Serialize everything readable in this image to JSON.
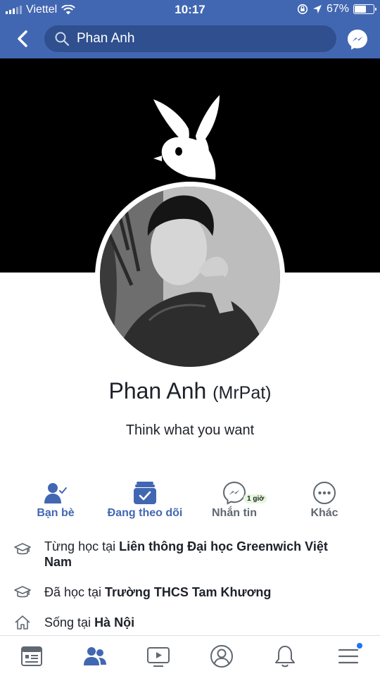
{
  "status_bar": {
    "carrier": "Viettel",
    "time": "10:17",
    "battery": "67%",
    "battery_level": 0.67
  },
  "search": {
    "query": "Phan Anh"
  },
  "profile": {
    "name": "Phan Anh",
    "alternate_name": "(MrPat)",
    "bio": "Think what you want"
  },
  "actions": [
    {
      "label": "Bạn bè",
      "icon": "friends-check-icon"
    },
    {
      "label": "Đang theo dõi",
      "icon": "following-check-icon"
    },
    {
      "label": "Nhắn tin",
      "icon": "messenger-icon",
      "badge": "1 giờ"
    },
    {
      "label": "Khác",
      "icon": "more-icon"
    }
  ],
  "info": [
    {
      "prefix": "Từng học tại ",
      "value": "Liên thông Đại học Greenwich Việt Nam",
      "icon": "graduation-cap-icon"
    },
    {
      "prefix": "Đã học tại ",
      "value": "Trường THCS Tam Khương",
      "icon": "graduation-cap-icon"
    },
    {
      "prefix": "Sống tại ",
      "value": "Hà Nội",
      "icon": "home-icon"
    }
  ],
  "bottom_nav": [
    "news-feed-icon",
    "friends-icon",
    "watch-icon",
    "profile-icon",
    "notifications-icon",
    "menu-icon"
  ],
  "colors": {
    "brand": "#4267b2",
    "search_bg": "#2f4f8e",
    "text": "#1d2129",
    "grey": "#606770",
    "notification_dot": "#1877f2"
  }
}
